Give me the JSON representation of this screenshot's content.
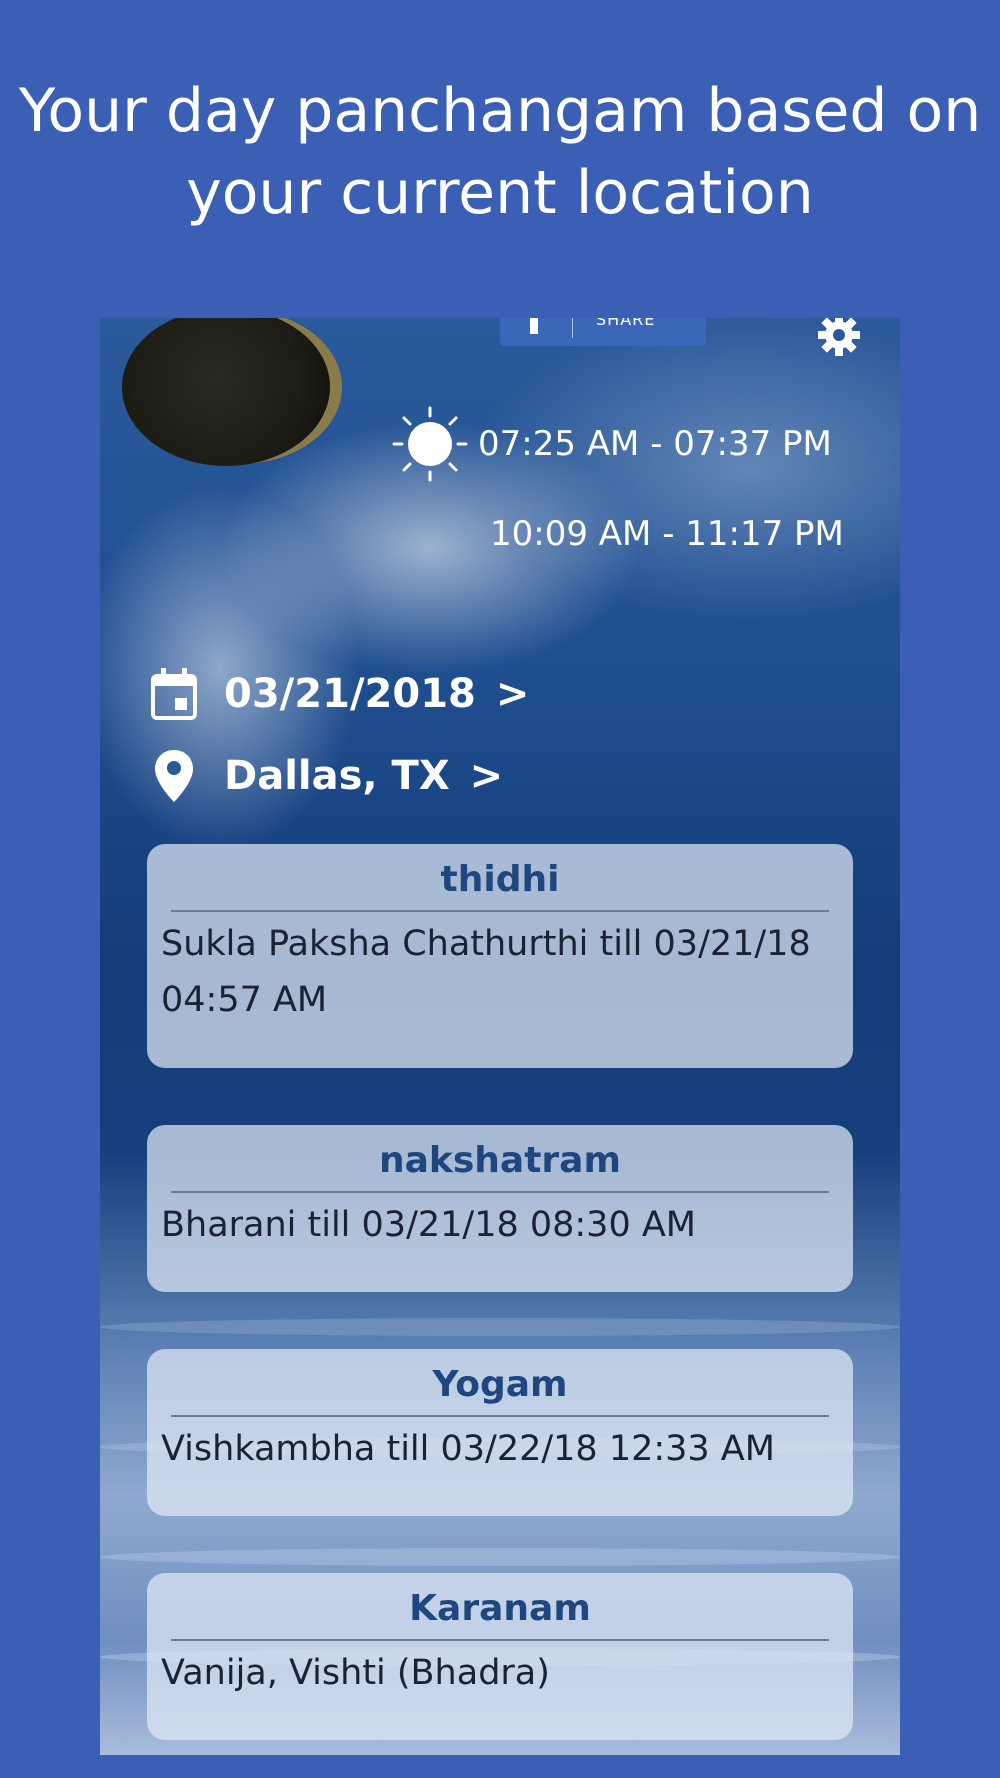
{
  "headline": {
    "line1": "Your day panchangam based on",
    "line2": "your current location"
  },
  "toolbar": {
    "share_label": "SHARE"
  },
  "sun": {
    "icon": "sun-icon",
    "times": "07:25 AM - 07:37 PM"
  },
  "moon": {
    "icon": "crescent-moon-icon",
    "times": "10:09 AM - 11:17 PM"
  },
  "date": {
    "icon": "calendar-icon",
    "value": "03/21/2018",
    "chevron": ">"
  },
  "location": {
    "icon": "location-pin-icon",
    "value": "Dallas, TX",
    "chevron": ">"
  },
  "cards": [
    {
      "title": "thidhi",
      "body": "Sukla Paksha Chathurthi till 03/21/18 04:57 AM"
    },
    {
      "title": "nakshatram",
      "body": "Bharani till 03/21/18 08:30 AM"
    },
    {
      "title": "Yogam",
      "body": "Vishkambha till 03/22/18 12:33 AM"
    },
    {
      "title": "Karanam",
      "body": "Vanija, Vishti (Bhadra)"
    }
  ],
  "colors": {
    "background": "#3a5fb5",
    "card_title": "#1f477f"
  }
}
